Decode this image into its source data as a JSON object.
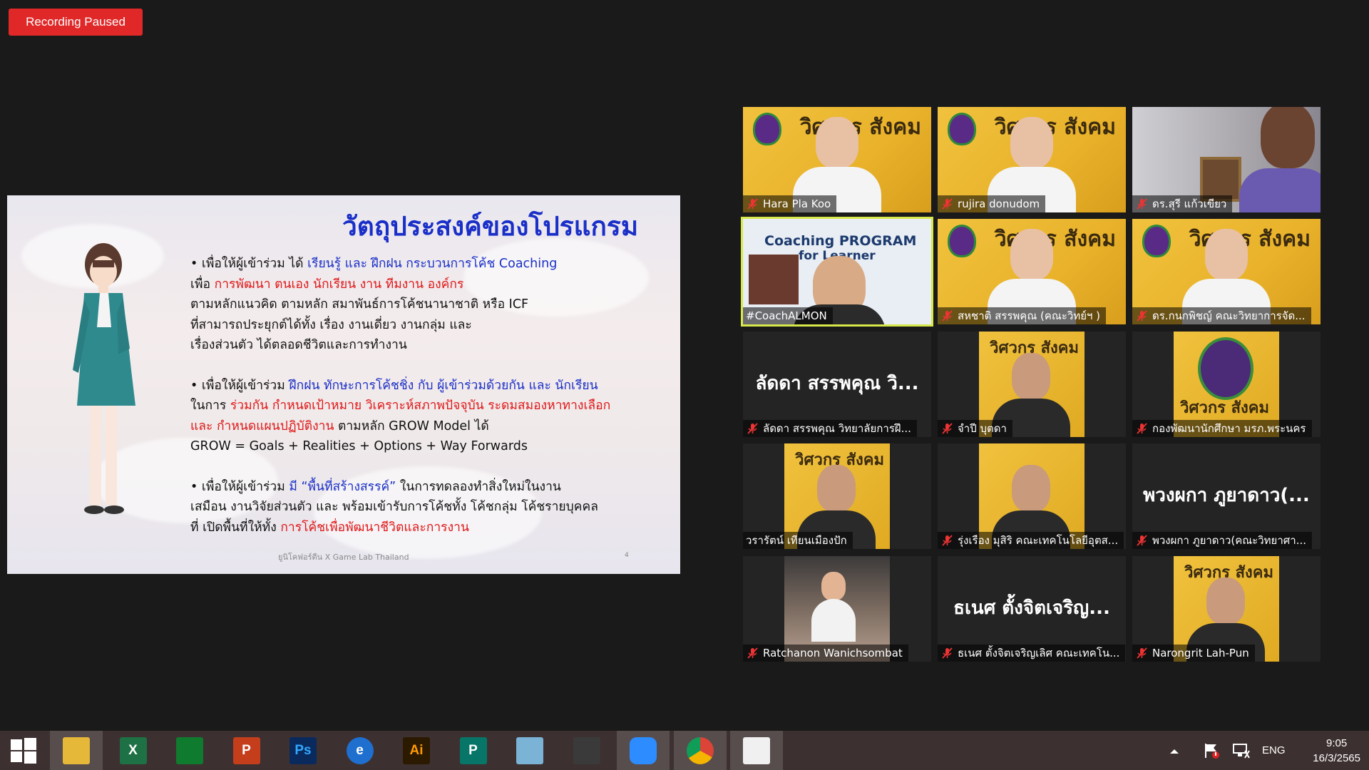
{
  "recording_badge": "Recording Paused",
  "slide": {
    "title": "วัตถุประสงค์ของโปรแกรม",
    "paragraphs": [
      [
        [
          {
            "t": "• เพื่อให้ผู้เข้าร่วม ได้ ",
            "c": ""
          },
          {
            "t": "เรียนรู้ และ ฝึกฝน กระบวนการโค้ช Coaching",
            "c": "blue"
          }
        ],
        [
          {
            "t": "เพื่อ ",
            "c": ""
          },
          {
            "t": "การพัฒนา ตนเอง นักเรียน งาน ทีมงาน องค์กร",
            "c": "red"
          }
        ],
        [
          {
            "t": "ตามหลักแนวคิด ตามหลัก สมาพันธ์การโค้ชนานาชาติ หรือ ICF",
            "c": ""
          }
        ],
        [
          {
            "t": "ที่สามารถประยุกต์ได้ทั้ง เรื่อง งานเดี่ยว งานกลุ่ม และ",
            "c": ""
          }
        ],
        [
          {
            "t": "เรื่องส่วนตัว ได้ตลอดชีวิตและการทำงาน",
            "c": ""
          }
        ]
      ],
      [
        [
          {
            "t": "• เพื่อให้ผู้เข้าร่วม ",
            "c": ""
          },
          {
            "t": "ฝึกฝน ทักษะการโค้ชชิ่ง กับ ผู้เข้าร่วมด้วยกัน และ นักเรียน",
            "c": "blue"
          }
        ],
        [
          {
            "t": "ในการ ",
            "c": ""
          },
          {
            "t": "ร่วมกัน กำหนดเป้าหมาย วิเคราะห์สภาพปัจจุบัน ระดมสมองหาทางเลือก",
            "c": "red"
          }
        ],
        [
          {
            "t": "และ กำหนดแผนปฏิบัติงาน",
            "c": "red"
          },
          {
            "t": " ตามหลัก GROW Model ได้",
            "c": ""
          }
        ],
        [
          {
            "t": "GROW = Goals + Realities + Options + Way Forwards",
            "c": ""
          }
        ]
      ],
      [
        [
          {
            "t": "• เพื่อให้ผู้เข้าร่วม ",
            "c": ""
          },
          {
            "t": "มี “พื้นที่สร้างสรรค์”",
            "c": "blue"
          },
          {
            "t": " ในการทดลองทำสิ่งใหม่ในงาน",
            "c": ""
          }
        ],
        [
          {
            "t": "เสมือน งานวิจัยส่วนตัว และ พร้อมเข้ารับการโค้ชทั้ง โค้ชกลุ่ม โค้ชรายบุคคล",
            "c": ""
          }
        ],
        [
          {
            "t": "ที่ เปิดพื้นที่ให้ทั้ง ",
            "c": ""
          },
          {
            "t": "การโค้ชเพื่อพัฒนาชีวิตและการงาน",
            "c": "red"
          }
        ]
      ]
    ],
    "footer": "ยูนิโคฟอร์ตีน X Game Lab Thailand",
    "page_number": "4"
  },
  "gallery": [
    {
      "name": "Hara Pla Koo",
      "muted": true,
      "type": "video",
      "brand": "วิศวกร สังคม"
    },
    {
      "name": "rujira donudom",
      "muted": true,
      "type": "video",
      "brand": "วิศวกร สังคม"
    },
    {
      "name": "ดร.สุรี แก้วเขียว",
      "muted": true,
      "type": "office"
    },
    {
      "name": "#CoachALMON",
      "muted": false,
      "type": "coach",
      "active": true,
      "overlay": "Coaching PROGRAM",
      "overlay2": "for Learner"
    },
    {
      "name": "สหชาติ สรรพคุณ (คณะวิทย์ฯ )",
      "muted": true,
      "type": "video",
      "brand": "วิศวกร สังคม"
    },
    {
      "name": "ดร.กนกพิชญ์ คณะวิทยาการจัด...",
      "muted": true,
      "type": "video",
      "brand": "วิศวกร สังคม"
    },
    {
      "name": "ลัดดา สรรพคุณ วิทยาลัยการฝึ...",
      "muted": true,
      "type": "text",
      "big": "ลัดดา สรรพคุณ วิ..."
    },
    {
      "name": "จำปี บุตดา",
      "muted": true,
      "type": "narrow",
      "brand": "วิศวกร สังคม"
    },
    {
      "name": "กองพัฒนานักศึกษา มรภ.พระนคร",
      "muted": true,
      "type": "narrowlogo",
      "brand": "วิศวกร สังคม"
    },
    {
      "name": "วรารัตน์ เทียนเมืองปัก",
      "muted": false,
      "type": "narrow",
      "brand": "วิศวกร สังคม"
    },
    {
      "name": "รุ่งเรือง มุสิริ คณะเทคโนโลยีอุตส...",
      "muted": true,
      "type": "narrow",
      "brand": ""
    },
    {
      "name": "พวงผกา ภูยาดาว(คณะวิทยาศา...",
      "muted": true,
      "type": "text",
      "big": "พวงผกา ภูยาดาว(..."
    },
    {
      "name": "Ratchanon Wanichsombat",
      "muted": true,
      "type": "food"
    },
    {
      "name": "ธเนศ ตั้งจิตเจริญเลิศ คณะเทคโน...",
      "muted": true,
      "type": "text",
      "big": "ธเนศ ตั้งจิตเจริญ..."
    },
    {
      "name": "Narongrit Lah-Pun",
      "muted": true,
      "type": "narrow",
      "brand": "วิศวกร สังคม"
    }
  ],
  "taskbar": {
    "apps": [
      {
        "icon": "file-explorer-icon",
        "label": "",
        "running": true
      },
      {
        "icon": "excel-icon",
        "label": "X",
        "running": false
      },
      {
        "icon": "store-icon",
        "label": "",
        "running": false
      },
      {
        "icon": "powerpoint-icon",
        "label": "P",
        "running": false
      },
      {
        "icon": "photoshop-icon",
        "label": "Ps",
        "running": false
      },
      {
        "icon": "internet-explorer-icon",
        "label": "e",
        "running": false
      },
      {
        "icon": "illustrator-icon",
        "label": "Ai",
        "running": false
      },
      {
        "icon": "publisher-icon",
        "label": "P",
        "running": false
      },
      {
        "icon": "notes-icon",
        "label": "",
        "running": false
      },
      {
        "icon": "photoscape-icon",
        "label": "",
        "running": false
      },
      {
        "icon": "zoom-icon",
        "label": "",
        "running": true
      },
      {
        "icon": "chrome-icon",
        "label": "",
        "running": true
      },
      {
        "icon": "photos-icon",
        "label": "",
        "running": true
      }
    ],
    "language": "ENG",
    "time": "9:05",
    "date": "16/3/2565"
  },
  "colors": {
    "badge": "#e02828",
    "active_outline": "#d7e84a",
    "slide_blue": "#1a2fc8",
    "slide_red": "#e01818",
    "taskbar": "#3d3030"
  }
}
